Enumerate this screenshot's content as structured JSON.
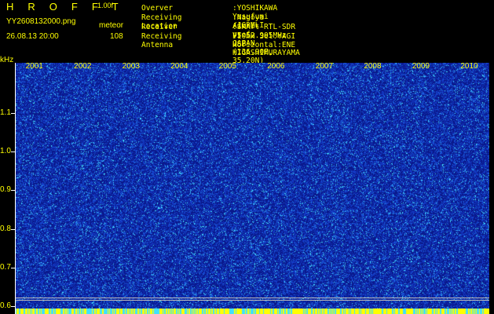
{
  "header": {
    "logo": "H R O F F T",
    "version": "1.00f",
    "filename": "YY2608132000.png",
    "mode": "meteor",
    "datetime": "26.08.13 20:00",
    "count": "108"
  },
  "info": [
    {
      "label": "Overver",
      "value": ":YOSHIKAWA Yasufumi /JG2MLI"
    },
    {
      "label": "Receiving Location",
      "value": ":Nagoya Aichi-pref. JAPAN (136.90E, 35.20N)"
    },
    {
      "label": "Receiver",
      "value": ":SMArt RTL-SDR V5 52.905MHz USB HIGASHIMURAYAMA"
    },
    {
      "label": "Receiving Antenna",
      "value": ":10mH 3el.YAGI Horizontal:ENE"
    }
  ],
  "colors": {
    "text": "#ffff00",
    "background": "#000000",
    "spectrum_low": "#0a1a8c",
    "spectrum_mid": "#1e5adc",
    "spectrum_high": "#46e6ff"
  },
  "chart_data": {
    "type": "heatmap",
    "y_unit": "kHz",
    "y_ticks": [
      "1.1",
      "1.0",
      "0.9",
      "0.8",
      "0.7",
      "0.6"
    ],
    "x_ticks": [
      "2001",
      "2002",
      "2003",
      "2004",
      "2005",
      "2006",
      "2007",
      "2008",
      "2009",
      "2010"
    ],
    "ylim": [
      0.58,
      1.23
    ],
    "xlim": [
      2000.6,
      2010.4
    ],
    "reference_lines_khz": [
      0.616,
      0.623
    ]
  }
}
